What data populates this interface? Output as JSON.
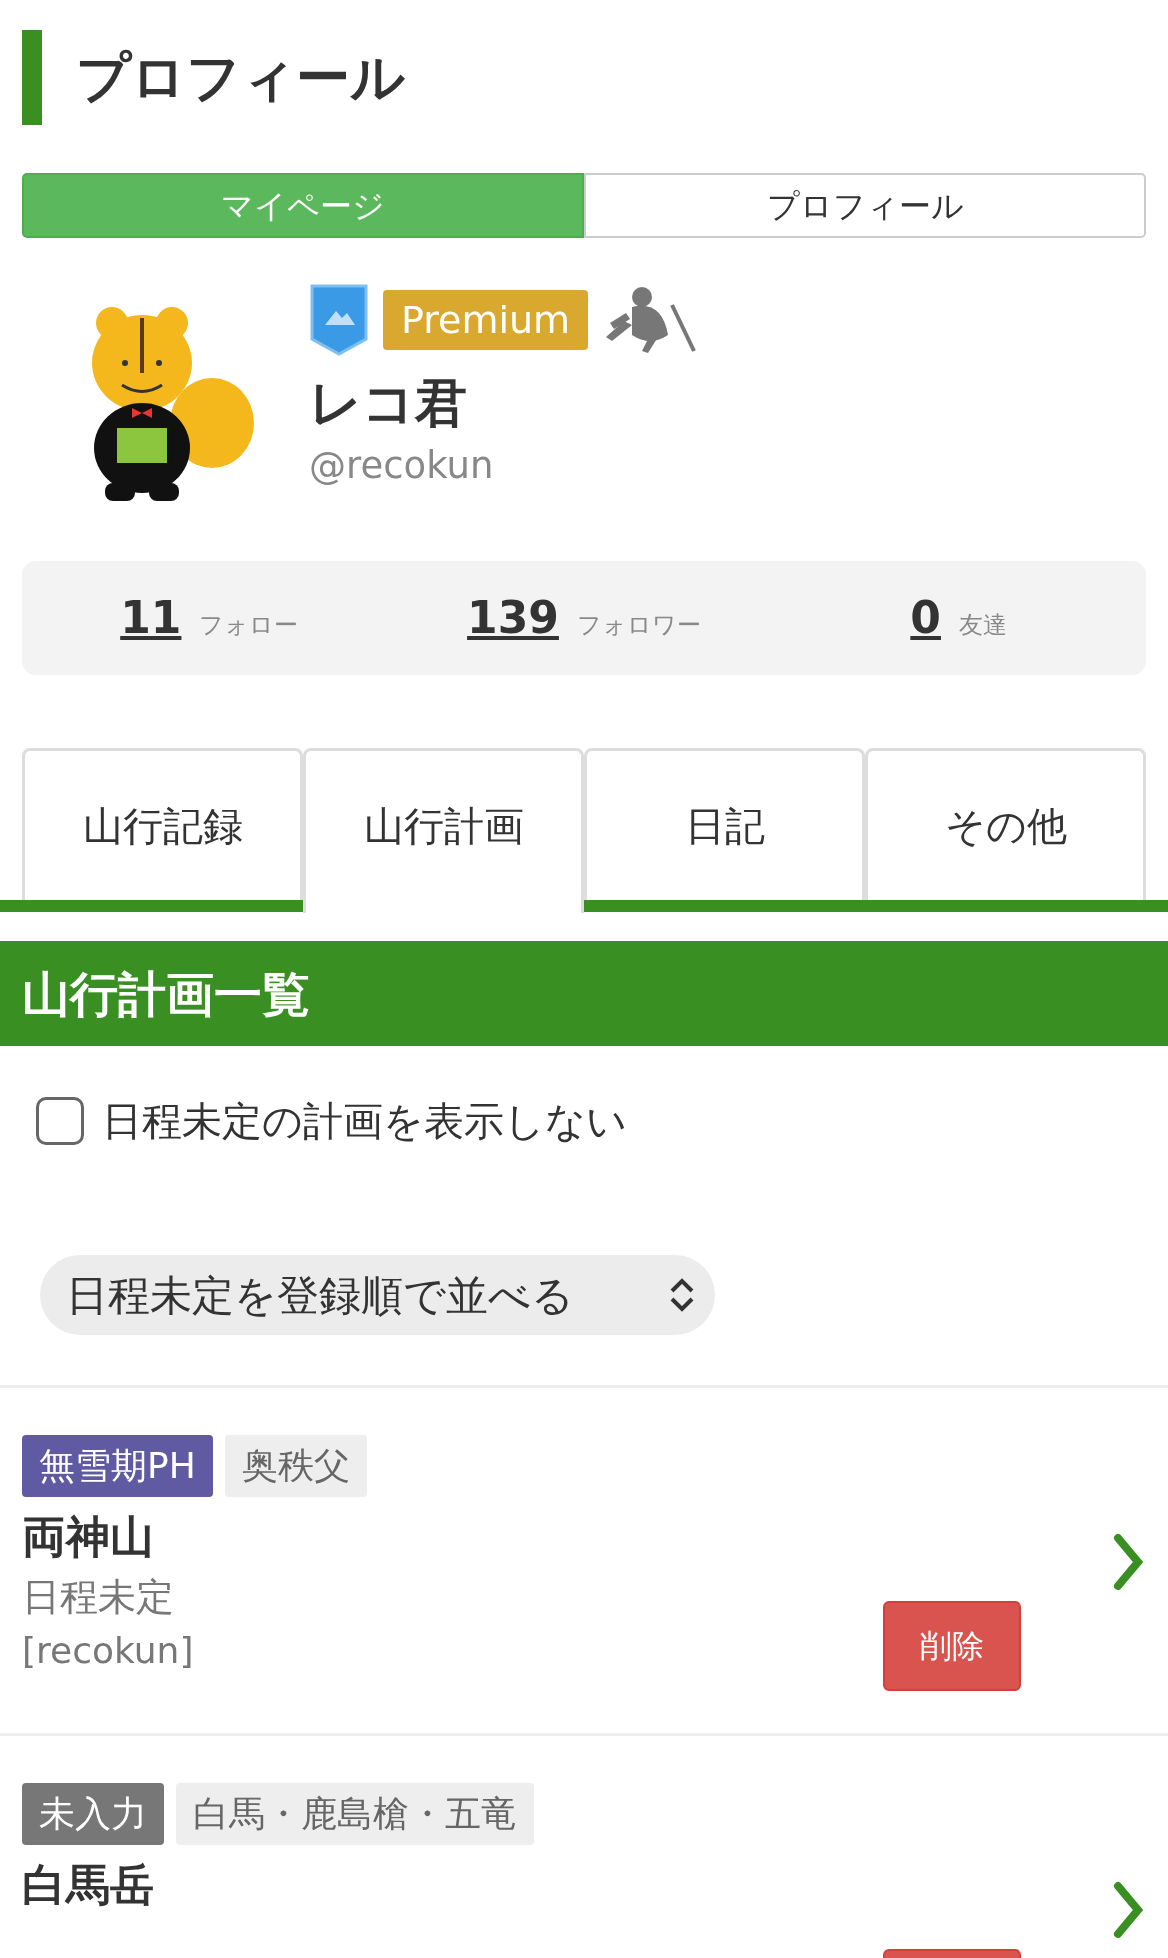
{
  "page_title": "プロフィール",
  "view_switch": [
    {
      "label": "マイページ",
      "selected": true
    },
    {
      "label": "プロフィール",
      "selected": false
    }
  ],
  "profile": {
    "badges": [
      {
        "kind": "shield"
      },
      {
        "kind": "label",
        "text": "Premium"
      },
      {
        "kind": "hiker"
      }
    ],
    "name": "レコ君",
    "handle": "@recokun"
  },
  "stats": [
    {
      "count": "11",
      "label": "フォロー"
    },
    {
      "count": "139",
      "label": "フォロワー"
    },
    {
      "count": "0",
      "label": "友達"
    }
  ],
  "tabs": [
    {
      "label": "山行記録",
      "selected": false
    },
    {
      "label": "山行計画",
      "selected": true
    },
    {
      "label": "日記",
      "selected": false
    },
    {
      "label": "その他",
      "selected": false
    }
  ],
  "section_title": "山行計画一覧",
  "hide_undated": {
    "label": "日程未定の計画を表示しない",
    "checked": false
  },
  "sort_select": {
    "value": "日程未定を登録順で並べる"
  },
  "plans": [
    {
      "tags": [
        {
          "text": "無雪期PH",
          "color": "#5f5aa2"
        },
        {
          "text": "奥秩父",
          "color": "#eeeeee"
        }
      ],
      "title": "両神山",
      "date": "日程未定",
      "user": "[recokun]",
      "delete_label": "削除"
    },
    {
      "tags": [
        {
          "text": "未入力",
          "color": "#777777"
        },
        {
          "text": "白馬・鹿島槍・五竜",
          "color": "#eeeeee"
        }
      ],
      "title": "白馬岳"
    }
  ]
}
